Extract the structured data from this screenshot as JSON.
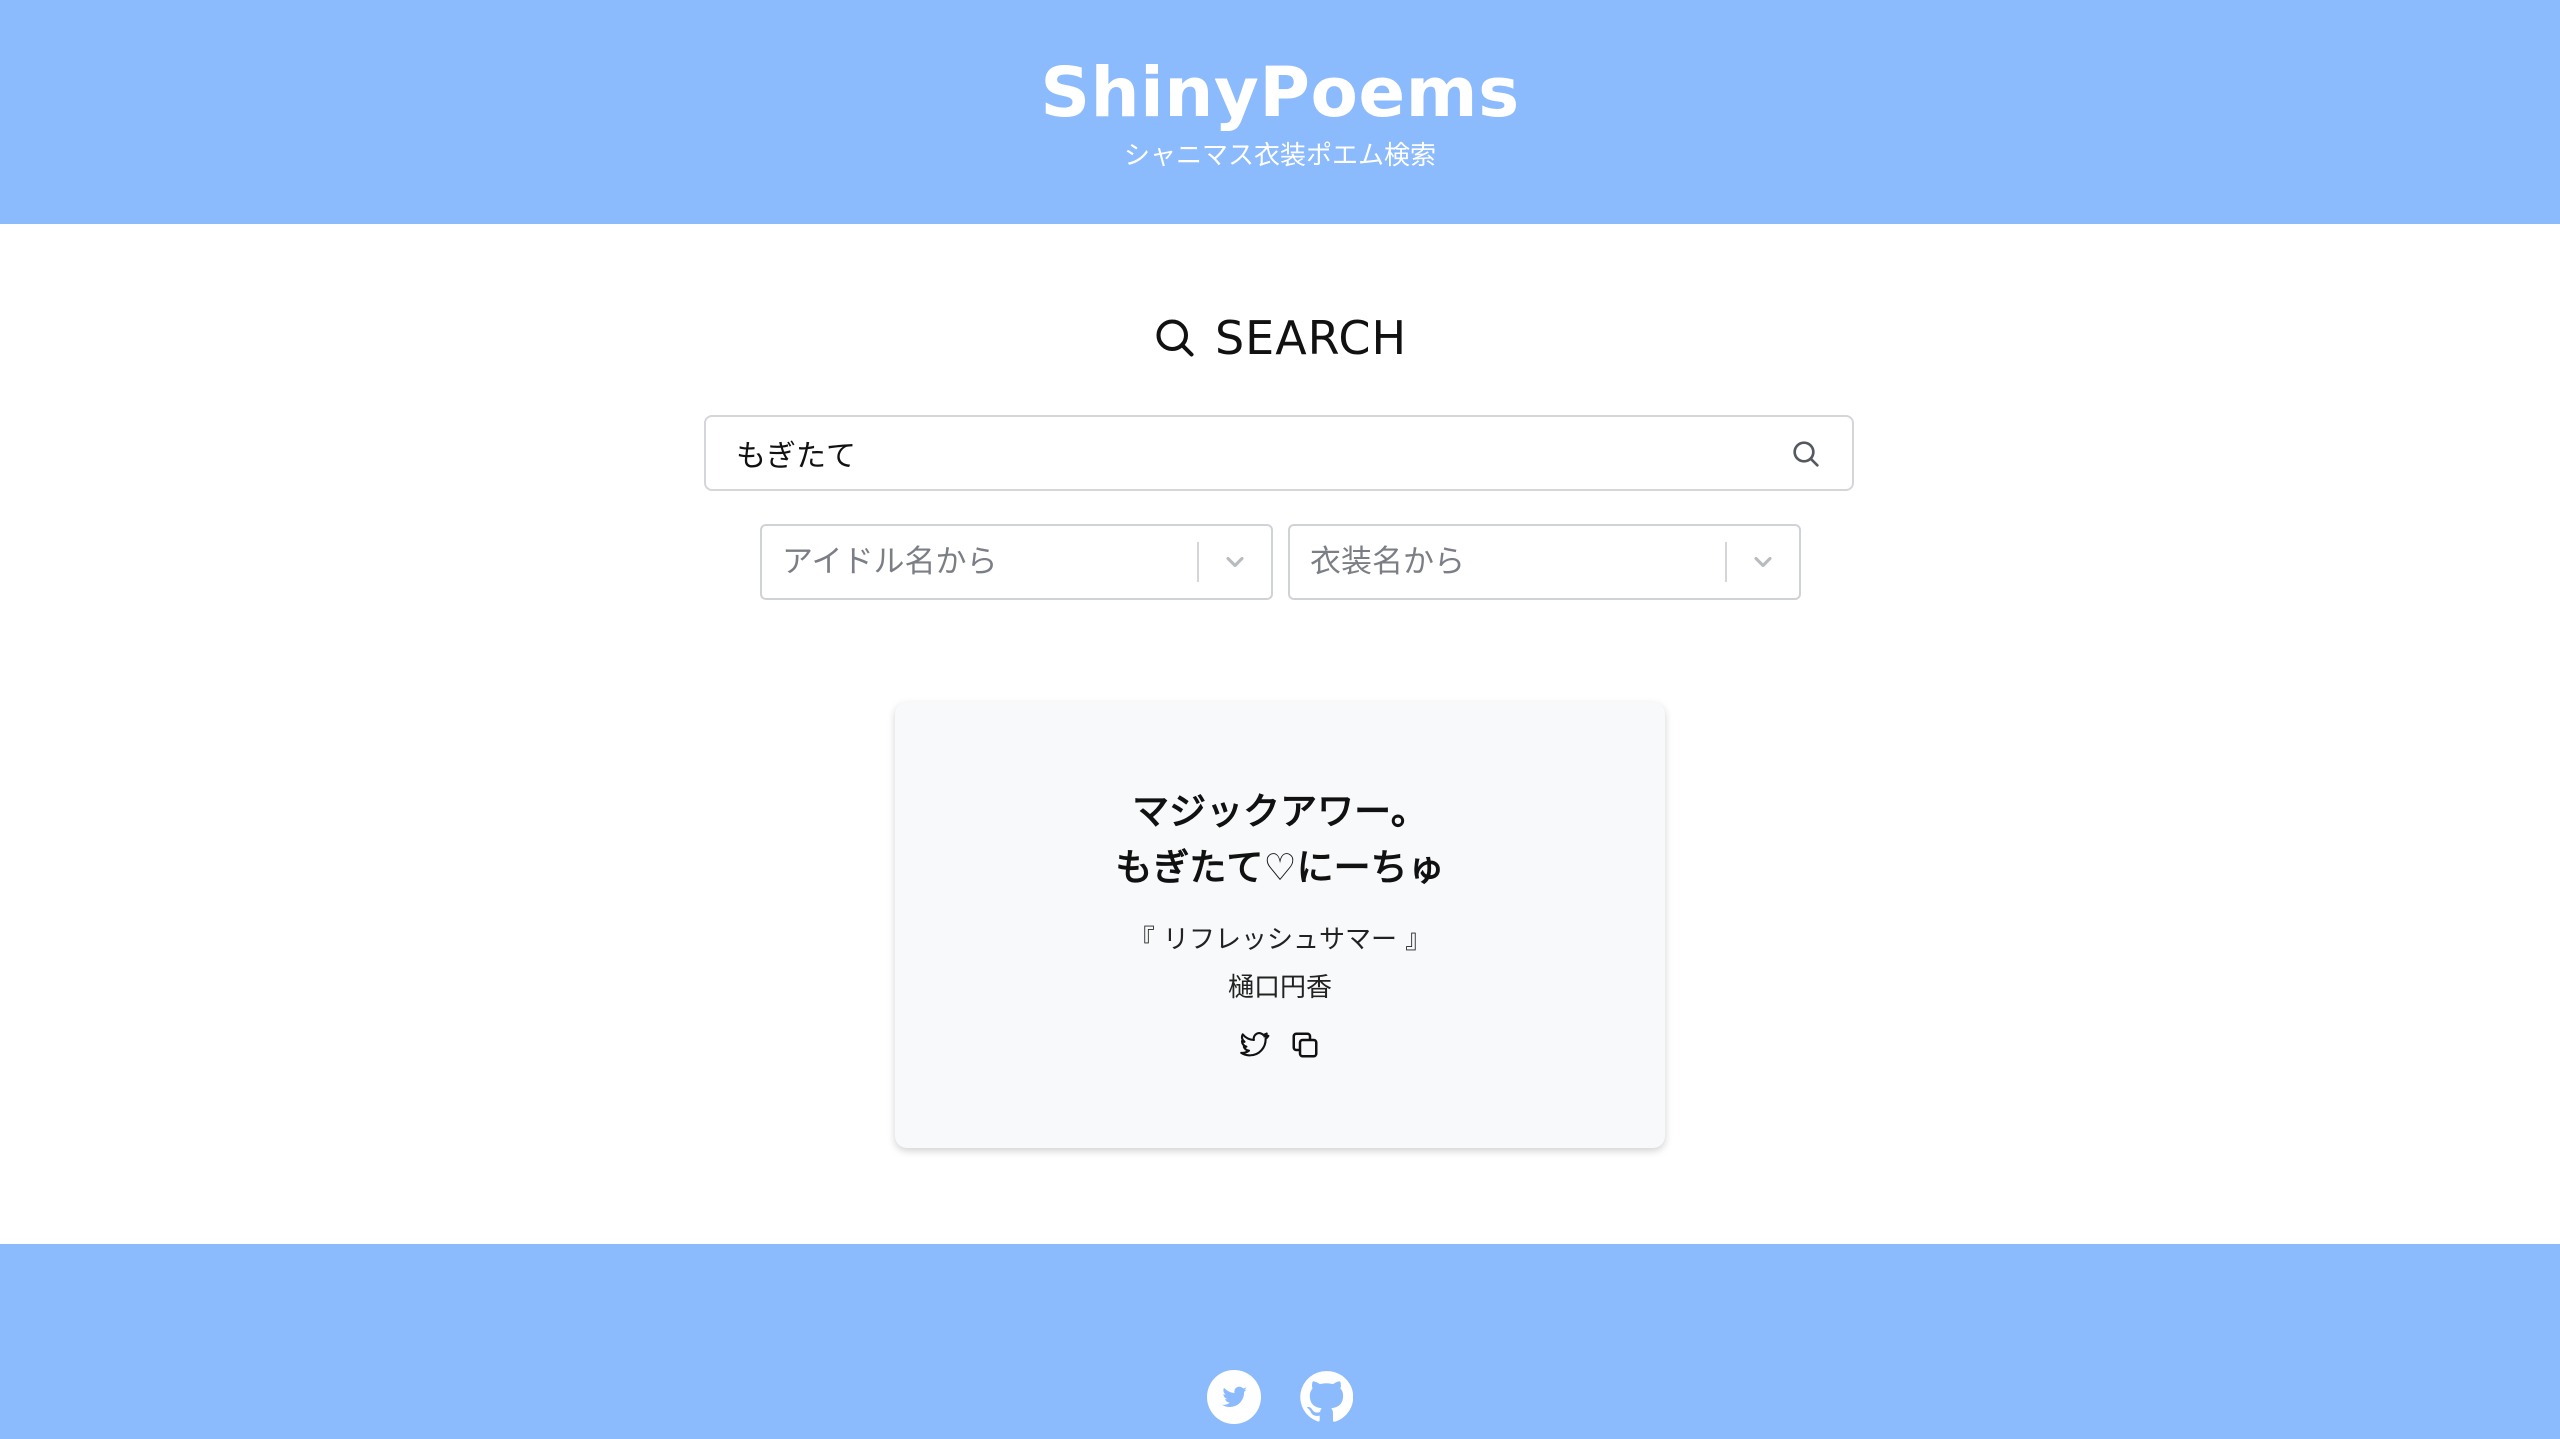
{
  "header": {
    "title": "ShinyPoems",
    "subtitle": "シャニマス衣装ポエム検索"
  },
  "search": {
    "heading": "SEARCH",
    "query": "もぎたて",
    "icon": "search-icon"
  },
  "filters": {
    "idol_placeholder": "アイドル名から",
    "costume_placeholder": "衣装名から"
  },
  "results": [
    {
      "poem_line1": "マジックアワー。",
      "poem_line2": "もぎたて♡にーちゅ",
      "costume": "『 リフレッシュサマー 』",
      "idol": "樋口円香",
      "actions": [
        "twitter-share-icon",
        "copy-icon"
      ]
    }
  ],
  "footer": {
    "links": [
      "twitter-icon",
      "github-icon"
    ]
  },
  "colors": {
    "header_bg": "#8cbbfd",
    "footer_bg": "#8cbbfd",
    "card_bg": "#f8f9fb"
  }
}
